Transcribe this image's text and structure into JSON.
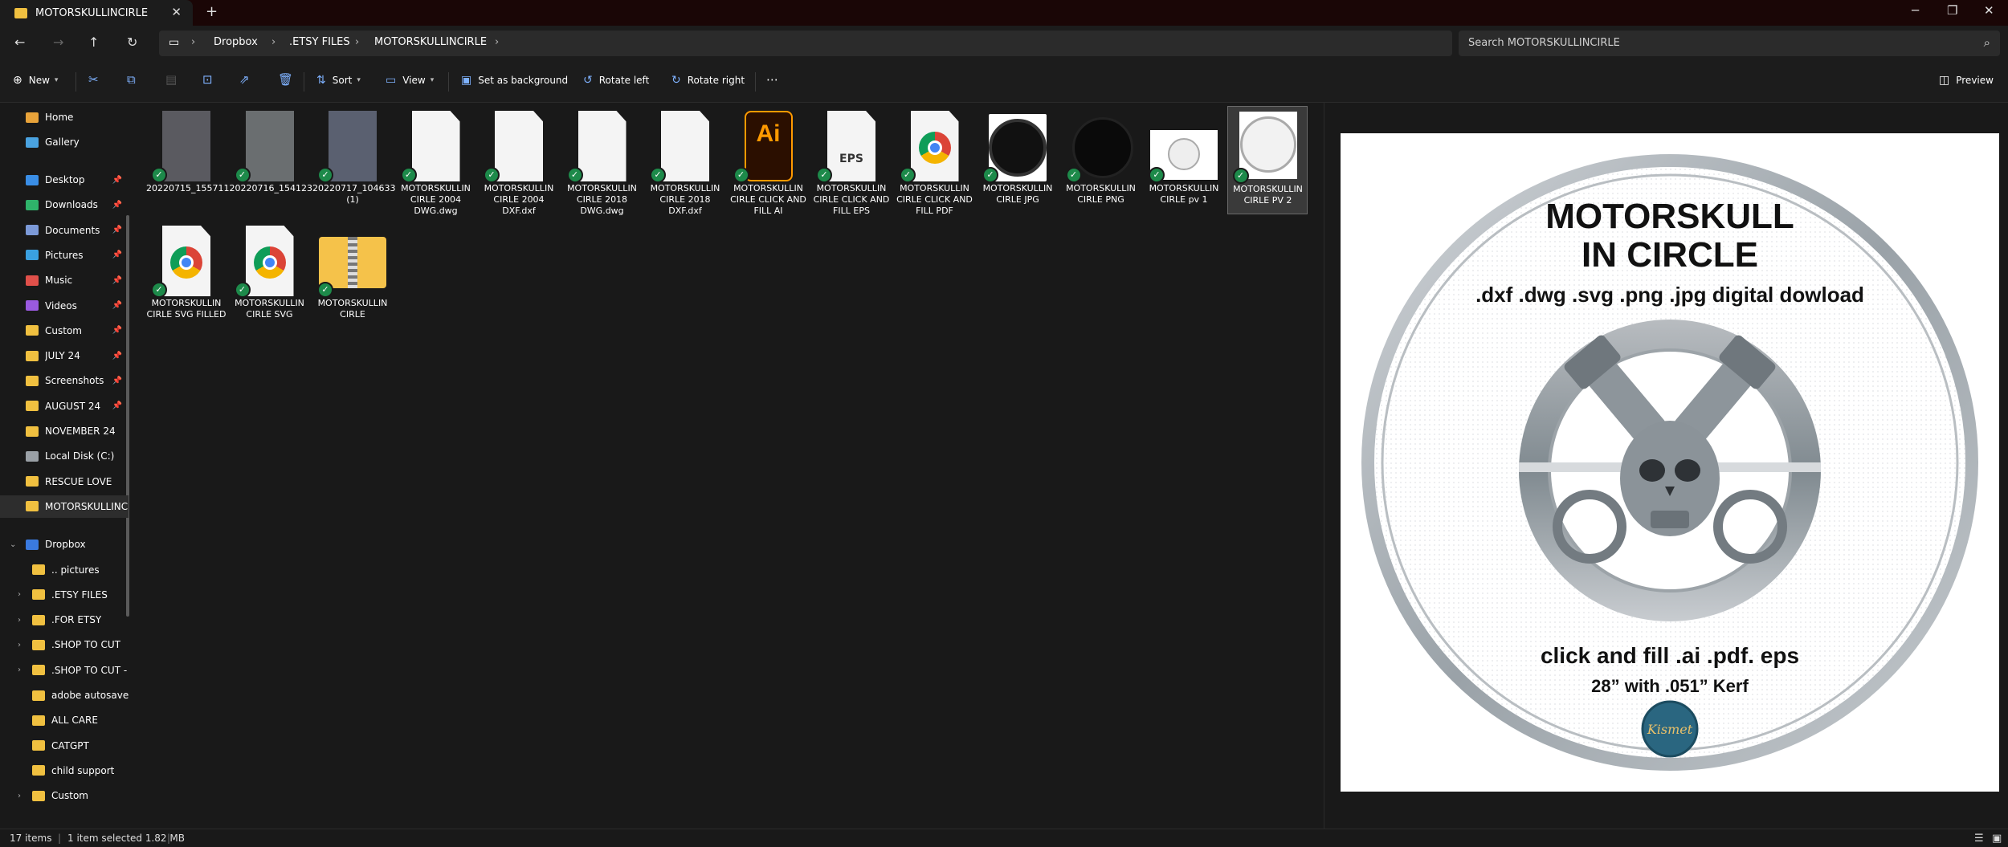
{
  "window": {
    "tab_title": "MOTORSKULLINCIRLE"
  },
  "breadcrumb": [
    "Dropbox",
    ".ETSY FILES",
    "MOTORSKULLINCIRLE"
  ],
  "search": {
    "placeholder": "Search MOTORSKULLINCIRLE"
  },
  "toolbar": {
    "new": "New",
    "sort": "Sort",
    "view": "View",
    "set_background": "Set as background",
    "rotate_left": "Rotate left",
    "rotate_right": "Rotate right",
    "preview": "Preview"
  },
  "sidebar": {
    "top": [
      {
        "label": "Home",
        "icon": "home-icon",
        "color": "#e8a33a"
      },
      {
        "label": "Gallery",
        "icon": "gallery-icon",
        "color": "#4aa3e0"
      }
    ],
    "quick": [
      {
        "label": "Desktop",
        "icon": "desktop-icon",
        "color": "#3a8ee6",
        "pinned": true
      },
      {
        "label": "Downloads",
        "icon": "downloads-icon",
        "color": "#2fb36a",
        "pinned": true
      },
      {
        "label": "Documents",
        "icon": "documents-icon",
        "color": "#7c9ad8",
        "pinned": true
      },
      {
        "label": "Pictures",
        "icon": "pictures-icon",
        "color": "#3aa0e0",
        "pinned": true
      },
      {
        "label": "Music",
        "icon": "music-icon",
        "color": "#e0504a",
        "pinned": true
      },
      {
        "label": "Videos",
        "icon": "videos-icon",
        "color": "#9a5ae0",
        "pinned": true
      },
      {
        "label": "Custom",
        "icon": "folder-icon",
        "color": "#f0c040",
        "pinned": true
      },
      {
        "label": "JULY 24",
        "icon": "folder-icon",
        "color": "#f0c040",
        "pinned": true
      },
      {
        "label": "Screenshots",
        "icon": "folder-icon",
        "color": "#f0c040",
        "pinned": true
      },
      {
        "label": "AUGUST 24",
        "icon": "folder-icon",
        "color": "#f0c040",
        "pinned": true
      },
      {
        "label": "NOVEMBER 24",
        "icon": "folder-icon",
        "color": "#f0c040",
        "pinned": false
      },
      {
        "label": "Local Disk (C:)",
        "icon": "drive-icon",
        "color": "#9aa0a6",
        "pinned": false
      },
      {
        "label": "RESCUE LOVE",
        "icon": "folder-icon",
        "color": "#f0c040",
        "pinned": false
      },
      {
        "label": "MOTORSKULLINCI",
        "icon": "folder-icon",
        "color": "#f0c040",
        "pinned": false
      }
    ],
    "dropbox": {
      "label": "Dropbox",
      "icon": "dropbox-icon",
      "color": "#3a7ae0"
    },
    "dropbox_children": [
      {
        "label": ".. pictures",
        "expandable": false
      },
      {
        "label": ".ETSY FILES",
        "expandable": true
      },
      {
        "label": ".FOR ETSY",
        "expandable": true
      },
      {
        "label": ".SHOP TO CUT",
        "expandable": true
      },
      {
        "label": ".SHOP TO CUT - (",
        "expandable": true
      },
      {
        "label": "adobe autosave",
        "expandable": false
      },
      {
        "label": "ALL CARE",
        "expandable": false
      },
      {
        "label": "CATGPT",
        "expandable": false
      },
      {
        "label": "child support",
        "expandable": false
      },
      {
        "label": "Custom",
        "expandable": true
      }
    ]
  },
  "files": [
    {
      "name": "20220715_155711",
      "kind": "photo",
      "color": "#5a5a60"
    },
    {
      "name": "20220716_154123",
      "kind": "photo",
      "color": "#6a6e70"
    },
    {
      "name": "20220717_104633 (1)",
      "kind": "photo",
      "color": "#5a6070"
    },
    {
      "name": "MOTORSKULLIN CIRLE 2004 DWG.dwg",
      "kind": "doc"
    },
    {
      "name": "MOTORSKULLIN CIRLE 2004 DXF.dxf",
      "kind": "doc"
    },
    {
      "name": "MOTORSKULLIN CIRLE 2018 DWG.dwg",
      "kind": "doc"
    },
    {
      "name": "MOTORSKULLIN CIRLE 2018 DXF.dxf",
      "kind": "doc"
    },
    {
      "name": "MOTORSKULLIN CIRLE CLICK AND FILL AI",
      "kind": "ai",
      "badge": "Ai"
    },
    {
      "name": "MOTORSKULLIN CIRLE CLICK AND FILL EPS",
      "kind": "eps",
      "badge": "EPS"
    },
    {
      "name": "MOTORSKULLIN CIRLE CLICK AND FILL PDF",
      "kind": "chrome"
    },
    {
      "name": "MOTORSKULLIN CIRLE JPG",
      "kind": "skull-jpg"
    },
    {
      "name": "MOTORSKULLIN CIRLE PNG",
      "kind": "skull-png"
    },
    {
      "name": "MOTORSKULLIN CIRLE pv 1",
      "kind": "pv1"
    },
    {
      "name": "MOTORSKULLIN CIRLE PV 2",
      "kind": "pv2",
      "selected": true
    },
    {
      "name": "MOTORSKULLIN CIRLE SVG FILLED",
      "kind": "chrome"
    },
    {
      "name": "MOTORSKULLIN CIRLE SVG",
      "kind": "chrome"
    },
    {
      "name": "MOTORSKULLIN CIRLE",
      "kind": "zip"
    }
  ],
  "preview": {
    "title_line1": "MOTORSKULL",
    "title_line2": "IN CIRCLE",
    "formats": ".dxf .dwg .svg .png .jpg digital dowload",
    "fill_line": "click and fill .ai .pdf. eps",
    "size_line": "28” with .051” Kerf",
    "logo_text": "Kismet"
  },
  "status": {
    "items": "17 items",
    "selection": "1 item selected  1.82 MB"
  }
}
